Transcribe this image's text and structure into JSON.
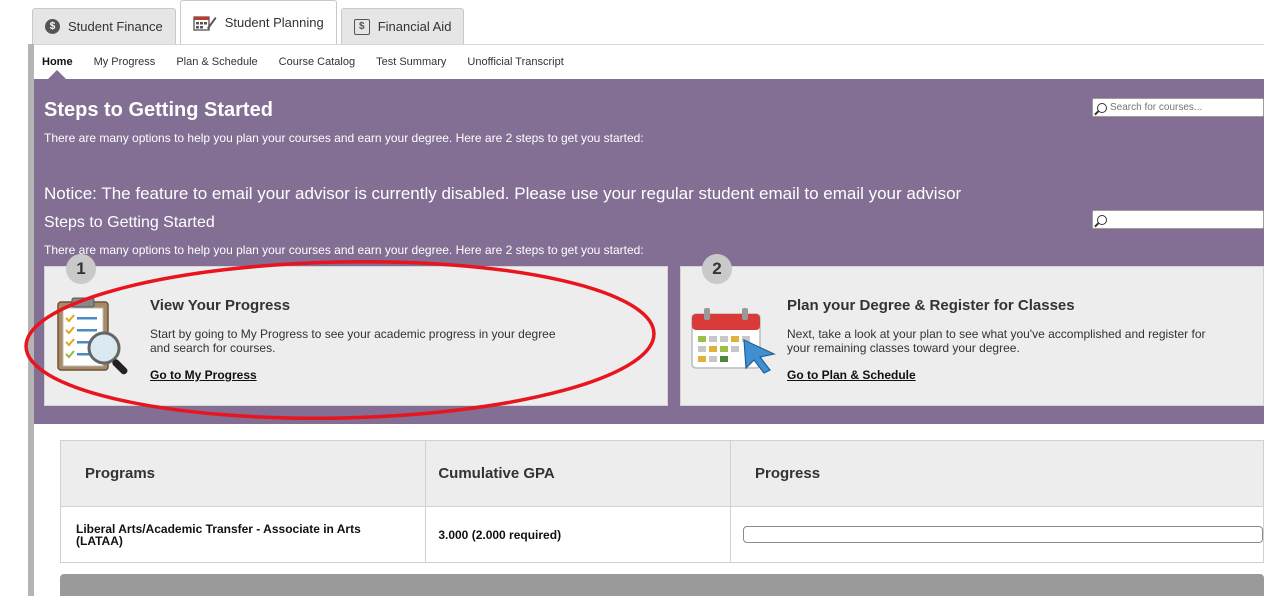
{
  "top_tabs": [
    {
      "label": "Student Finance",
      "icon": "dollar-circle-icon"
    },
    {
      "label": "Student Planning",
      "icon": "calendar-pencil-icon"
    },
    {
      "label": "Financial Aid",
      "icon": "money-icon"
    }
  ],
  "subnav": [
    "Home",
    "My Progress",
    "Plan & Schedule",
    "Course Catalog",
    "Test Summary",
    "Unofficial Transcript"
  ],
  "hero": {
    "title": "Steps to Getting Started",
    "subtitle": "There are many options to help you plan your courses and earn your degree. Here are 2 steps to get you started:",
    "notice": "Notice: The feature to email your advisor is currently disabled. Please use your regular student email to email your advisor",
    "title2": "Steps to Getting Started",
    "subtitle2": "There are many options to help you plan your courses and earn your degree. Here are 2 steps to get you started:",
    "search_placeholder": "Search for courses...",
    "search2_placeholder": ""
  },
  "cards": [
    {
      "step": "1",
      "title": "View Your Progress",
      "text_line1": "Start by going to My Progress to see your academic progress in your degree",
      "text_line2": "and search for courses.",
      "link": "Go to My Progress",
      "icon": "clipboard-magnifier-icon"
    },
    {
      "step": "2",
      "title": "Plan your Degree & Register for Classes",
      "text_line1": "Next, take a look at your plan to see what you've accomplished and register for",
      "text_line2": "your remaining classes toward your degree.",
      "link": "Go to Plan & Schedule",
      "icon": "calendar-cursor-icon"
    }
  ],
  "table": {
    "headers": [
      "Programs",
      "Cumulative GPA",
      "Progress"
    ],
    "rows": [
      {
        "program_line1": "Liberal Arts/Academic Transfer - Associate in Arts",
        "program_line2": "(LATAA)",
        "gpa": "3.000 (2.000 required)",
        "progress": 0
      }
    ]
  },
  "colors": {
    "accent": "#836e94",
    "annotation": "#e8141e"
  }
}
